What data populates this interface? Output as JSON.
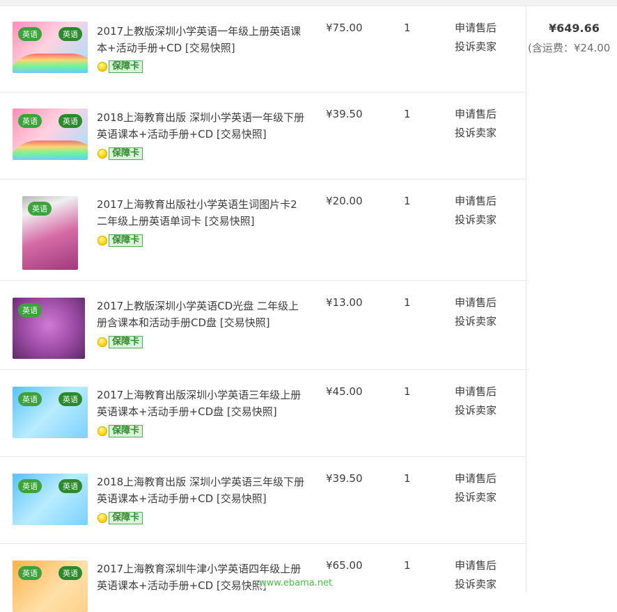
{
  "items": [
    {
      "title": "2017上教版深圳小学英语一年级上册英语课本+活动手册+CD [交易快照]",
      "price": "¥75.00",
      "qty": "1",
      "guarantee": "保障卡",
      "actions": [
        "申请售后",
        "投诉卖家"
      ],
      "image": {
        "badge": "英语",
        "badge2": "英语"
      }
    },
    {
      "title": "2018上海教育出版 深圳小学英语一年级下册英语课本+活动手册+CD [交易快照]",
      "price": "¥39.50",
      "qty": "1",
      "guarantee": "保障卡",
      "actions": [
        "申请售后",
        "投诉卖家"
      ],
      "image": {
        "badge": "英语",
        "badge2": "英语"
      }
    },
    {
      "title": "2017上海教育出版社小学英语生词图片卡2二年级上册英语单词卡 [交易快照]",
      "price": "¥20.00",
      "qty": "1",
      "guarantee": "保障卡",
      "actions": [
        "申请售后",
        "投诉卖家"
      ],
      "image": {
        "badge": "英语"
      }
    },
    {
      "title": "2017上教版深圳小学英语CD光盘 二年级上册含课本和活动手册CD盘 [交易快照]",
      "price": "¥13.00",
      "qty": "1",
      "guarantee": "保障卡",
      "actions": [
        "申请售后",
        "投诉卖家"
      ],
      "image": {
        "badge": "英语"
      }
    },
    {
      "title": "2017上海教育出版深圳小学英语三年级上册英语课本+活动手册+CD盘 [交易快照]",
      "price": "¥45.00",
      "qty": "1",
      "guarantee": "保障卡",
      "actions": [
        "申请售后",
        "投诉卖家"
      ],
      "image": {
        "badge": "英语",
        "badge2": "英语"
      }
    },
    {
      "title": "2018上海教育出版 深圳小学英语三年级下册英语课本+活动手册+CD [交易快照]",
      "price": "¥39.50",
      "qty": "1",
      "guarantee": "保障卡",
      "actions": [
        "申请售后",
        "投诉卖家"
      ],
      "image": {
        "badge": "英语",
        "badge2": "英语"
      }
    },
    {
      "title": "2017上海教育深圳牛津小学英语四年级上册英语课本+活动手册+CD [交易快照]",
      "price": "¥65.00",
      "qty": "1",
      "actions": [
        "申请售后",
        "投诉卖家"
      ],
      "image": {
        "badge": "英语",
        "badge2": "英语"
      }
    }
  ],
  "summary": {
    "total": "¥649.66",
    "shipping": "(含运费：¥24.00"
  },
  "watermark": "www.ebama.net"
}
